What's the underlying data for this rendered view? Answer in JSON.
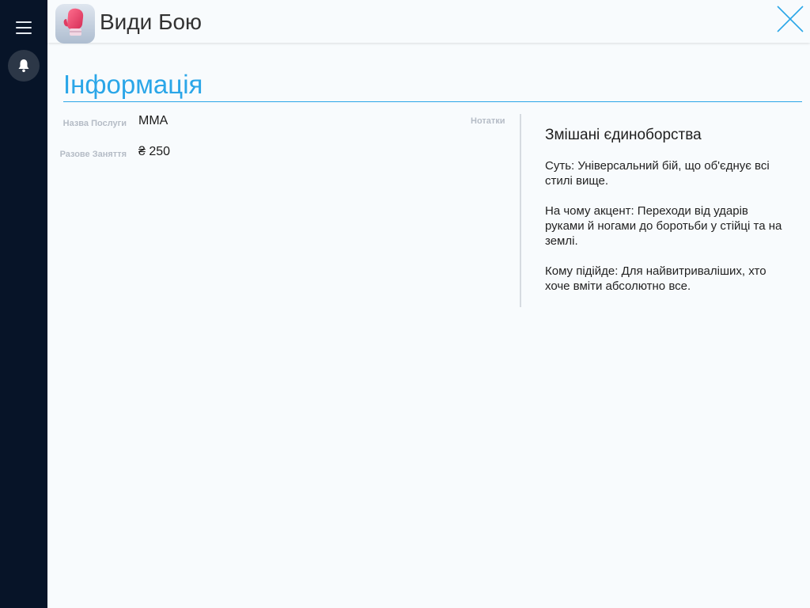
{
  "header": {
    "title": "Види Бою",
    "app_icon": "boxing-glove-icon",
    "close_icon": "close-icon"
  },
  "sidebar": {
    "menu_icon": "hamburger-menu-icon",
    "notification_icon": "bell-icon"
  },
  "section": {
    "title": "Інформація"
  },
  "fields": [
    {
      "label": "Назва Послуги",
      "value": "MMA"
    },
    {
      "label": "Разове Заняття",
      "value": "₴ 250"
    }
  ],
  "notes": {
    "label": "Нотатки",
    "heading": "Змішані єдиноборства",
    "paragraphs": [
      "Суть: Універсальний бій, що об'єднує всі стилі вище.",
      "На чому акцент: Переходи від ударів руками й ногами до боротьби у стійці та на землі.",
      "Кому підійде: Для найвитриваліших, хто хоче вміти абсолютно все."
    ]
  },
  "colors": {
    "sidebar_bg": "#071428",
    "accent": "#2aa6e8",
    "page_bg": "#f8fbfd",
    "glove": "#e8456a"
  }
}
